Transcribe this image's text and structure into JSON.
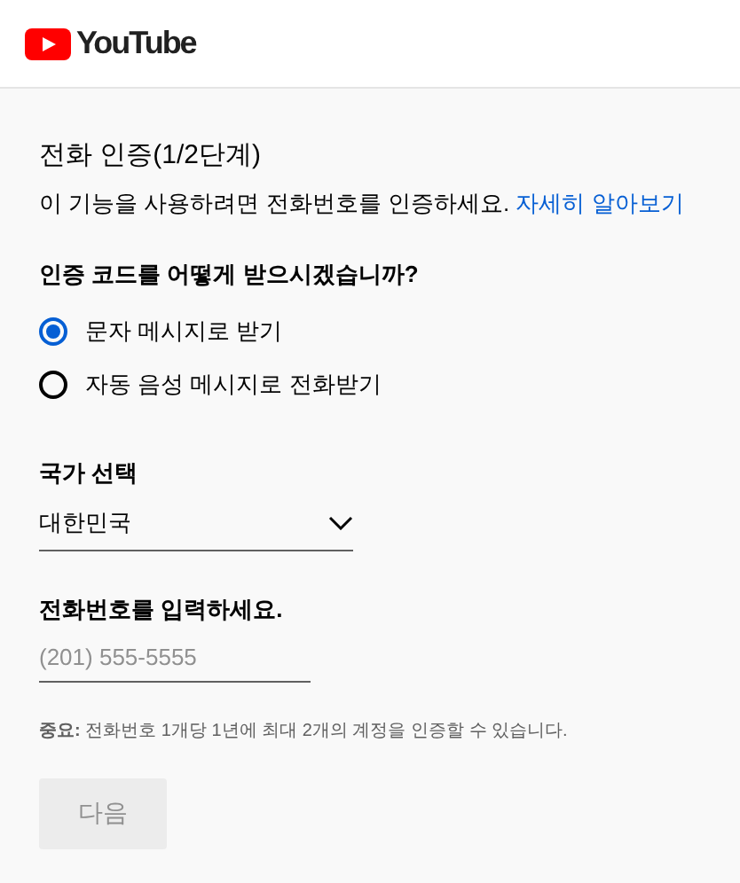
{
  "header": {
    "logo_text": "YouTube"
  },
  "title": "전화 인증(1/2단계)",
  "description": {
    "text": "이 기능을 사용하려면 전화번호를 인증하세요.",
    "link": "자세히 알아보기"
  },
  "question": "인증 코드를 어떻게 받으시겠습니까?",
  "options": [
    {
      "label": "문자 메시지로 받기",
      "selected": true
    },
    {
      "label": "자동 음성 메시지로 전화받기",
      "selected": false
    }
  ],
  "country": {
    "label": "국가 선택",
    "value": "대한민국"
  },
  "phone": {
    "label": "전화번호를 입력하세요.",
    "placeholder": "(201) 555-5555"
  },
  "note": "**중요:** 전화번호 1개당 1년에 최대 2개의 계정을 인증할 수 있습니다.",
  "next_button": {
    "label": "다음",
    "disabled": true
  }
}
